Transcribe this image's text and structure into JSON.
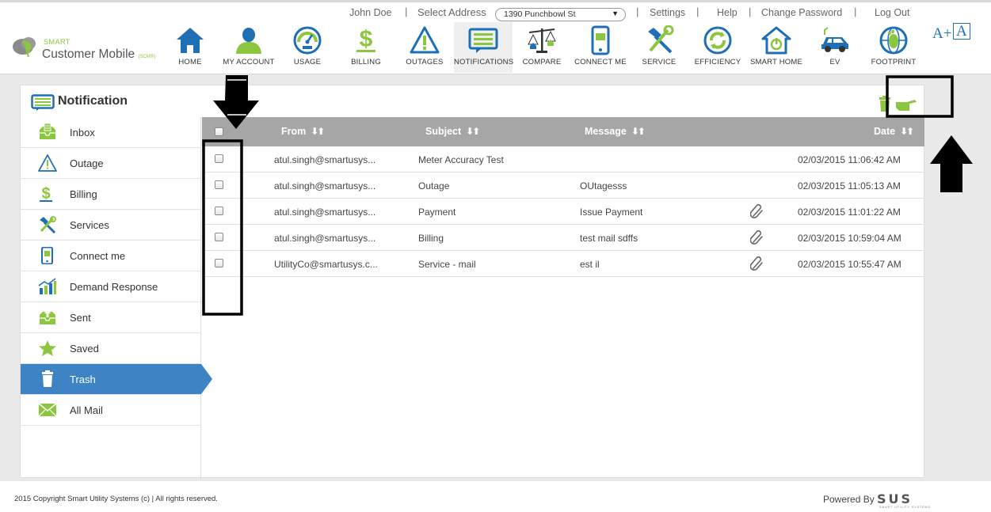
{
  "topbar": {
    "user_name": "John Doe",
    "select_address_label": "Select Address",
    "address_value": "1390 Punchbowl St",
    "settings": "Settings",
    "help": "Help",
    "change_password": "Change Password",
    "logout": "Log Out",
    "separator": "|"
  },
  "logo": {
    "small": "SMART",
    "big": "Customer Mobile",
    "suffix": "(SCM®)"
  },
  "nav": {
    "items": [
      {
        "label": "HOME",
        "icon": "home-icon"
      },
      {
        "label": "MY ACCOUNT",
        "icon": "user-icon"
      },
      {
        "label": "USAGE",
        "icon": "gauge-icon"
      },
      {
        "label": "BILLING",
        "icon": "dollar-icon"
      },
      {
        "label": "OUTAGES",
        "icon": "warning-icon"
      },
      {
        "label": "NOTIFICATIONS",
        "icon": "notification-icon"
      },
      {
        "label": "COMPARE",
        "icon": "scale-icon"
      },
      {
        "label": "CONNECT ME",
        "icon": "phone-icon"
      },
      {
        "label": "SERVICE",
        "icon": "tools-icon"
      },
      {
        "label": "EFFICIENCY",
        "icon": "recycle-icon"
      },
      {
        "label": "SMART HOME",
        "icon": "smart-home-icon"
      },
      {
        "label": "EV",
        "icon": "car-icon"
      },
      {
        "label": "FOOTPRINT",
        "icon": "globe-icon"
      }
    ],
    "active": "NOTIFICATIONS",
    "font_increase": "A+",
    "font_default": "A"
  },
  "panel": {
    "title": "Notification"
  },
  "sidebar": {
    "items": [
      {
        "label": "Inbox",
        "icon": "inbox-icon"
      },
      {
        "label": "Outage",
        "icon": "warning-icon"
      },
      {
        "label": "Billing",
        "icon": "dollar-icon"
      },
      {
        "label": "Services",
        "icon": "tools-icon"
      },
      {
        "label": "Connect me",
        "icon": "phone-icon"
      },
      {
        "label": "Demand Response",
        "icon": "bar-chart-icon"
      },
      {
        "label": "Sent",
        "icon": "sent-icon"
      },
      {
        "label": "Saved",
        "icon": "star-icon"
      },
      {
        "label": "Trash",
        "icon": "trash-icon"
      },
      {
        "label": "All Mail",
        "icon": "mail-icon"
      }
    ],
    "active": "Trash"
  },
  "table": {
    "headers": {
      "from": "From",
      "subject": "Subject",
      "message": "Message",
      "date": "Date"
    },
    "rows": [
      {
        "from": "atul.singh@smartusys...",
        "subject": "Meter Accuracy Test",
        "message": "",
        "attachment": false,
        "date": "02/03/2015 11:06:42 AM"
      },
      {
        "from": "atul.singh@smartusys...",
        "subject": "Outage",
        "message": "OUtagesss",
        "attachment": false,
        "date": "02/03/2015 11:05:13 AM"
      },
      {
        "from": "atul.singh@smartusys...",
        "subject": "Payment",
        "message": "Issue Payment",
        "attachment": true,
        "date": "02/03/2015 11:01:22 AM"
      },
      {
        "from": "atul.singh@smartusys...",
        "subject": "Billing",
        "message": "test mail sdffs",
        "attachment": true,
        "date": "02/03/2015 10:59:04 AM"
      },
      {
        "from": "UtilityCo@smartusys.c...",
        "subject": "Service - mail",
        "message": "est il",
        "attachment": true,
        "date": "02/03/2015 10:55:47 AM"
      }
    ]
  },
  "footer": {
    "copyright": "2015 Copyright Smart Utility Systems (c) | All rights reserved.",
    "powered_by": "Powered By",
    "brand": "SUS",
    "brand_sub": "SMART UTILITY SYSTEMS"
  },
  "colors": {
    "accent_blue": "#3e84c4",
    "icon_blue": "#1e6fb5",
    "icon_green": "#8cc63f",
    "table_header": "#a6a6a6"
  }
}
